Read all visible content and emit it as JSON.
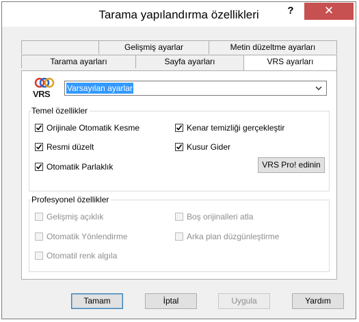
{
  "window": {
    "title": "Tarama yapılandırma özellikleri",
    "help_label": "?",
    "close_label": "✕"
  },
  "tabs": {
    "back_row": [
      {
        "label": ""
      },
      {
        "label": "Gelişmiş ayarlar"
      },
      {
        "label": "Metin düzeltme ayarları"
      }
    ],
    "front_row": [
      {
        "label": "Tarama ayarları"
      },
      {
        "label": "Sayfa ayarları"
      },
      {
        "label": "VRS ayarları",
        "active": true
      }
    ]
  },
  "vrs": {
    "logo_text": "VRS",
    "preset_value": "Varsayılan ayarlar",
    "basic": {
      "title": "Temel özellikler",
      "items": [
        {
          "label": "Orijinale Otomatik Kesme",
          "checked": true
        },
        {
          "label": "Kenar temizliği gerçekleştir",
          "checked": true
        },
        {
          "label": "Resmi düzelt",
          "checked": true
        },
        {
          "label": "Kusur Gider",
          "checked": true
        },
        {
          "label": "Otomatik Parlaklık",
          "checked": true
        }
      ],
      "pro_button": "VRS Pro! edinin"
    },
    "pro": {
      "title": "Profesyonel özellikler",
      "items": [
        {
          "label": "Gelişmiş açıklık",
          "checked": false
        },
        {
          "label": "Boş orijinalleri atla",
          "checked": false
        },
        {
          "label": "Otomatik Yönlendirme",
          "checked": false
        },
        {
          "label": "Arka plan düzgünleştirme",
          "checked": false
        },
        {
          "label": "Otomatil renk algıla",
          "checked": false
        }
      ]
    }
  },
  "buttons": {
    "ok": "Tamam",
    "cancel": "İptal",
    "apply": "Uygula",
    "help": "Yardım"
  },
  "colors": {
    "close_button": "#c75050",
    "selection": "#3399ff",
    "dialog_bg": "#f0f0f0"
  }
}
